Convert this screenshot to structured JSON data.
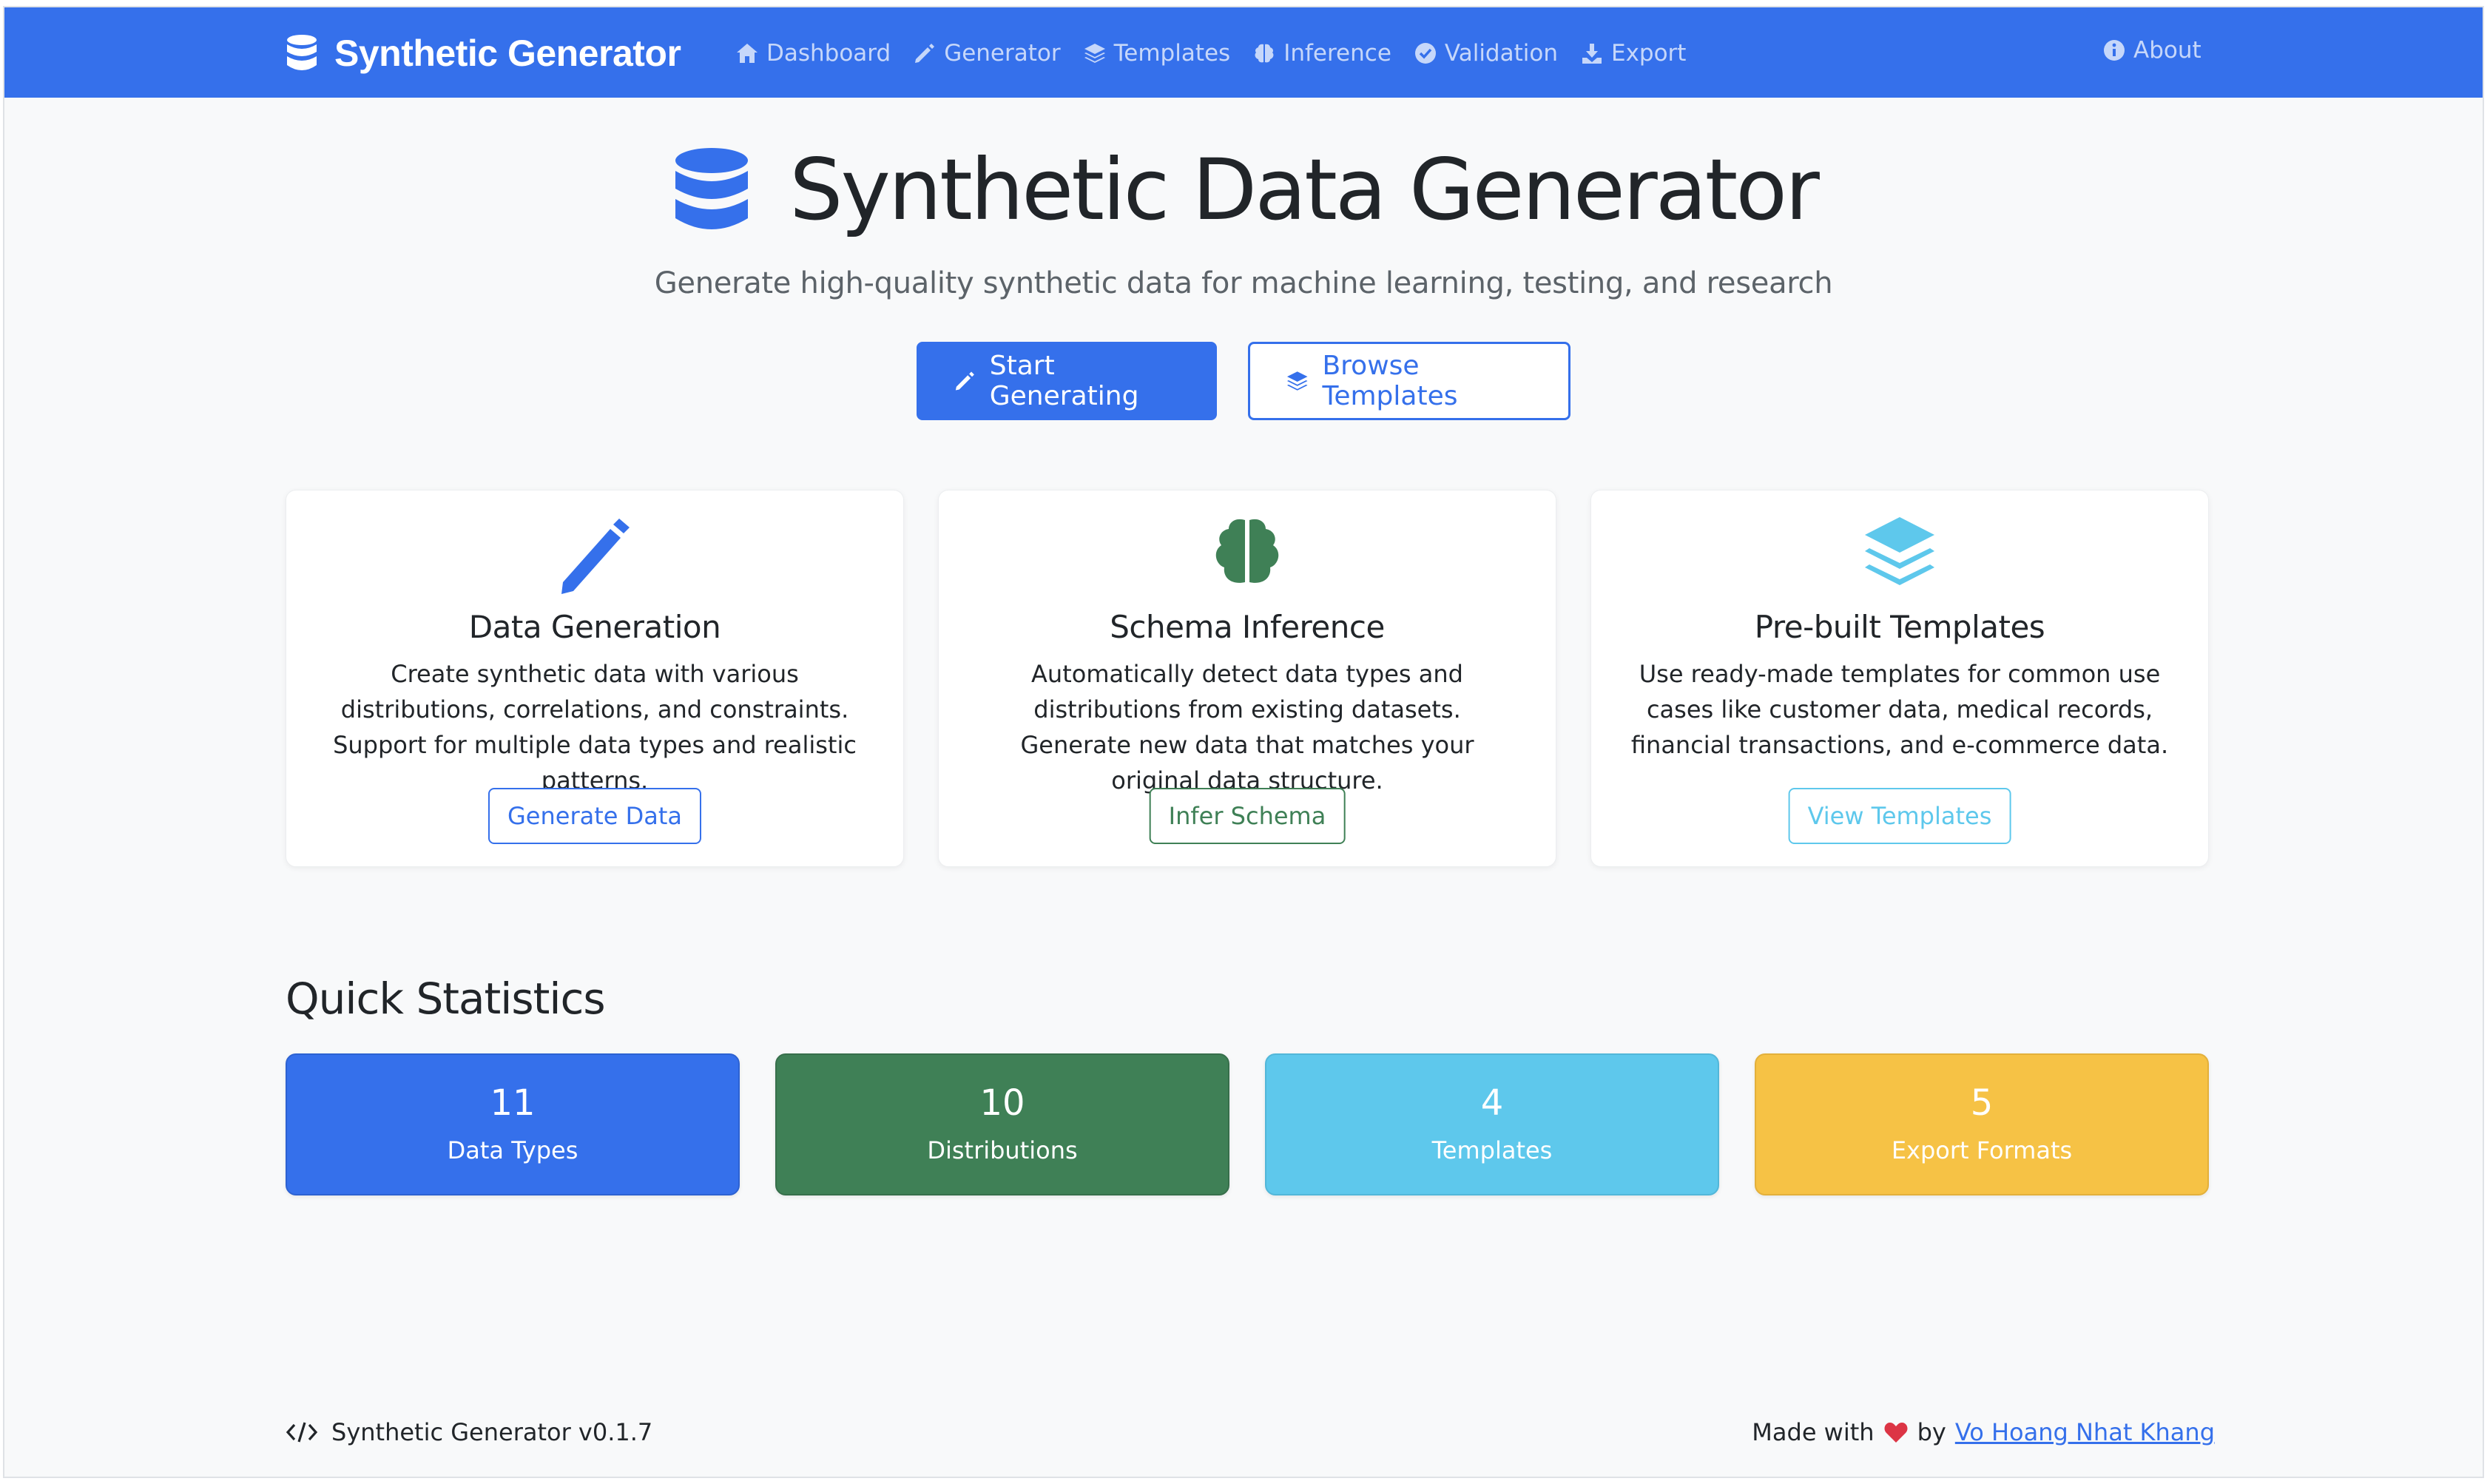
{
  "colors": {
    "primary": "#3570eb",
    "success": "#3f8056",
    "info": "#5ec8ec",
    "warning": "#f6c245",
    "heart": "#dc3545"
  },
  "navbar": {
    "brand": "Synthetic Generator",
    "brand_icon": "database-icon",
    "links": [
      {
        "label": "Dashboard",
        "icon": "home-icon"
      },
      {
        "label": "Generator",
        "icon": "pencil-icon"
      },
      {
        "label": "Templates",
        "icon": "layers-icon"
      },
      {
        "label": "Inference",
        "icon": "brain-icon"
      },
      {
        "label": "Validation",
        "icon": "check-circle-icon"
      },
      {
        "label": "Export",
        "icon": "download-icon"
      }
    ],
    "about": {
      "label": "About",
      "icon": "info-circle-icon"
    }
  },
  "hero": {
    "title": "Synthetic Data Generator",
    "subtitle": "Generate high-quality synthetic data for machine learning, testing, and research",
    "primary_button": "Start Generating",
    "secondary_button": "Browse Templates"
  },
  "features": [
    {
      "title": "Data Generation",
      "icon": "pencil-icon",
      "description": "Create synthetic data with various distributions, correlations, and constraints. Support for multiple data types and realistic patterns.",
      "button": "Generate Data"
    },
    {
      "title": "Schema Inference",
      "icon": "brain-icon",
      "description": "Automatically detect data types and distributions from existing datasets. Generate new data that matches your original data structure.",
      "button": "Infer Schema"
    },
    {
      "title": "Pre-built Templates",
      "icon": "layers-icon",
      "description": "Use ready-made templates for common use cases like customer data, medical records, financial transactions, and e-commerce data.",
      "button": "View Templates"
    }
  ],
  "stats": {
    "title": "Quick Statistics",
    "items": [
      {
        "value": "11",
        "label": "Data Types"
      },
      {
        "value": "10",
        "label": "Distributions"
      },
      {
        "value": "4",
        "label": "Templates"
      },
      {
        "value": "5",
        "label": "Export Formats"
      }
    ]
  },
  "footer": {
    "version": "Synthetic Generator v0.1.7",
    "made_with": "Made with",
    "by": "by",
    "author": "Vo Hoang Nhat Khang"
  }
}
